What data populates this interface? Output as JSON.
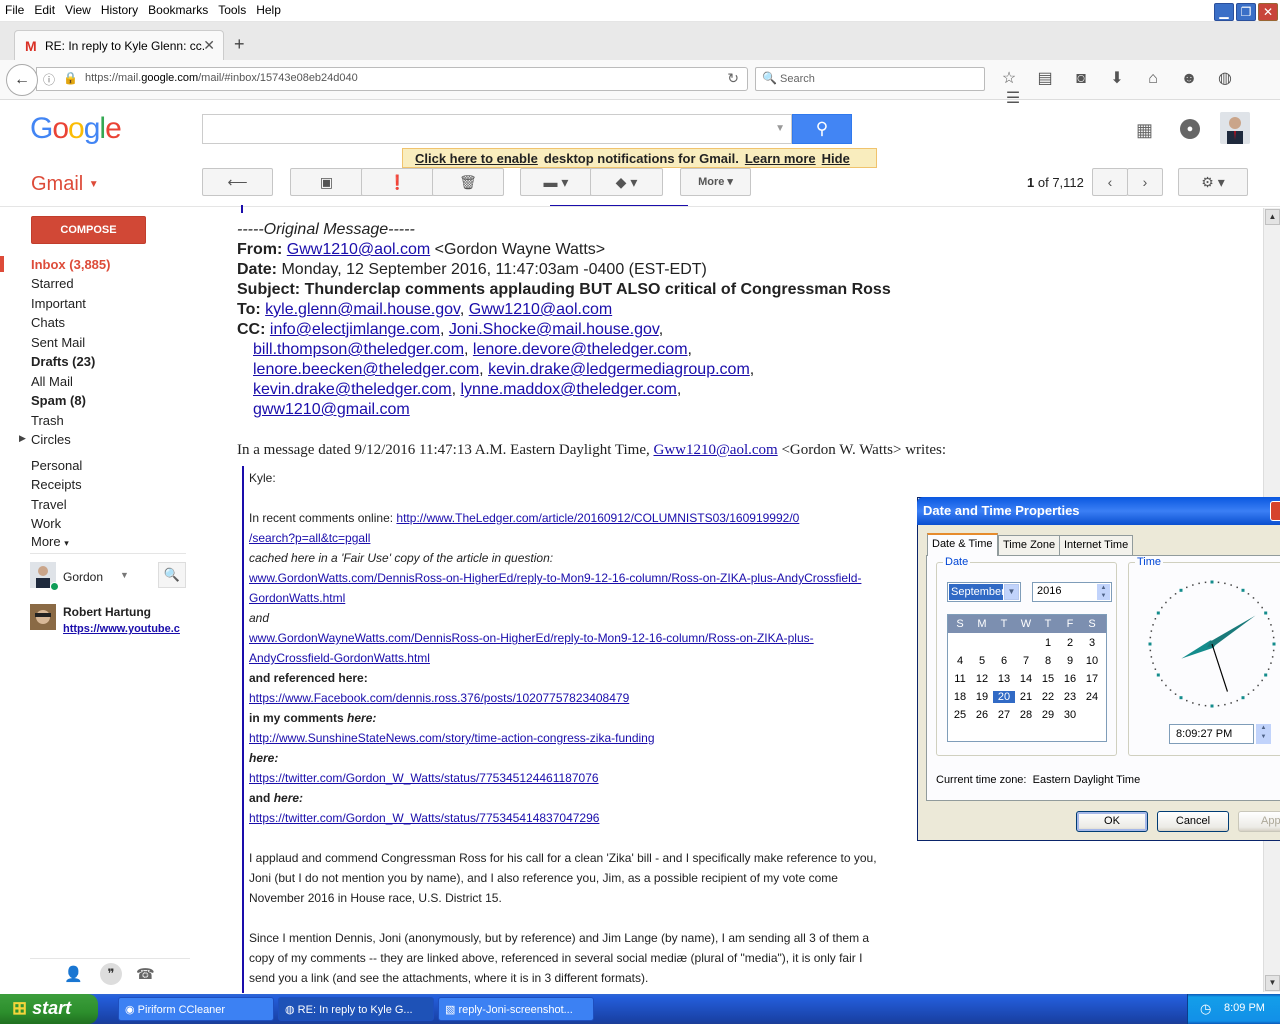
{
  "menu": [
    "File",
    "Edit",
    "View",
    "History",
    "Bookmarks",
    "Tools",
    "Help"
  ],
  "browser": {
    "tab_title": "RE: In reply to Kyle Glenn: cc...",
    "url_pre": "https://mail.",
    "url_host": "google.com",
    "url_post": "/mail/#inbox/15743e08eb24d040",
    "search_placeholder": "Search"
  },
  "google": {
    "logo": "Google"
  },
  "notification": {
    "enable": "Click here to enable",
    "rest": "desktop notifications for Gmail.",
    "learn": "Learn more",
    "hide": "Hide"
  },
  "gmail": {
    "label": "Gmail",
    "more": "More",
    "pager_current": "1",
    "pager_of": "of",
    "pager_total": "7,112",
    "compose": "COMPOSE",
    "nav": [
      {
        "label": "Inbox (3,885)"
      },
      {
        "label": "Starred"
      },
      {
        "label": "Important"
      },
      {
        "label": "Chats"
      },
      {
        "label": "Sent Mail"
      },
      {
        "label": "Drafts (23)"
      },
      {
        "label": "All Mail"
      },
      {
        "label": "Spam (8)"
      },
      {
        "label": "Trash"
      },
      {
        "label": "Circles"
      },
      {
        "label": "Personal"
      },
      {
        "label": "Receipts"
      },
      {
        "label": "Travel"
      },
      {
        "label": "Work"
      },
      {
        "label": "More"
      }
    ],
    "hangouts_user": "Gordon",
    "contact_name": "Robert Hartung",
    "contact_link": "https://www.youtube.c"
  },
  "email": {
    "orig": "-----Original Message-----",
    "from_label": "From:",
    "from_addr": "Gww1210@aol.com",
    "from_name": "<Gordon Wayne Watts>",
    "date_label": "Date:",
    "date_val": "Monday, 12 September 2016, 11:47:03am -0400 (EST-EDT)",
    "subject": "Subject: Thunderclap comments applauding BUT ALSO critical of Congressman Ross",
    "to_label": "To:",
    "to1": "kyle.glenn@mail.house.gov",
    "to2": "Gww1210@aol.com",
    "cc_label": "CC:",
    "cc1": "info@electjimlange.com",
    "cc2": "Joni.Shocke@mail.house.gov",
    "cc3": "bill.thompson@theledger.com",
    "cc4": "lenore.devore@theledger.com",
    "cc5": "lenore.beecken@theledger.com",
    "cc6": "kevin.drake@ledgermediagroup.com",
    "cc7": "kevin.drake@theledger.com",
    "cc8": "lynne.maddox@theledger.com",
    "cc9": "gww1210@gmail.com",
    "msg_pre": "In a message dated 9/12/2016 11:47:13 A.M. Eastern Daylight Time,",
    "msg_addr": "Gww1210@aol.com",
    "msg_post": "<Gordon W. Watts> writes:",
    "salut": "Kyle:",
    "l1_pre": "In recent comments online:",
    "l1_link": "http://www.TheLedger.com/article/20160912/COLUMNISTS03/160919992/0",
    "l2_link": "/search?p=all&tc=pgall",
    "l3": "cached here in a 'Fair Use' copy of the article in question:",
    "l4_link": "www.GordonWatts.com/DennisRoss-on-HigherEd/reply-to-Mon9-12-16-column/Ross-on-ZIKA-plus-AndyCrossfield-",
    "l5_link": "GordonWatts.html",
    "l6": "and",
    "l7_link": "www.GordonWayneWatts.com/DennisRoss-on-HigherEd/reply-to-Mon9-12-16-column/Ross-on-ZIKA-plus-",
    "l8_link": "AndyCrossfield-GordonWatts.html",
    "l9": "and referenced here:",
    "l10_link": "https://www.Facebook.com/dennis.ross.376/posts/10207757823408479",
    "l11_a": "in my comments",
    "l11_b": "here:",
    "l12_link": "http://www.SunshineStateNews.com/story/time-action-congress-zika-funding",
    "l13": "here:",
    "l14_link": "https://twitter.com/Gordon_W_Watts/status/775345124461187076",
    "l15_a": "and",
    "l15_b": "here:",
    "l16_link": "https://twitter.com/Gordon_W_Watts/status/775345414837047296",
    "p1": "I applaud and commend Congressman Ross for his call for a clean 'Zika' bill - and I specifically make reference to you,",
    "p2": "Joni (but I do not mention you by name), and I also reference you, Jim, as a possible recipient of my vote come",
    "p3": "November 2016 in House race, U.S. District 15.",
    "p4": "Since I mention Dennis, Joni (anonymously, but by reference) and Jim Lange (by name), I am sending all 3 of them a",
    "p5": "copy of my comments -- they are linked above, referenced in several social mediæ (plural of \"media\"), it is only fair I",
    "p6": "send you a link (and see the attachments, where it is in 3 different formats)."
  },
  "dialog": {
    "title": "Date and Time Properties",
    "tabs": [
      "Date & Time",
      "Time Zone",
      "Internet Time"
    ],
    "date_legend": "Date",
    "time_legend": "Time",
    "month": "September",
    "year": "2016",
    "weekdays": [
      "S",
      "M",
      "T",
      "W",
      "T",
      "F",
      "S"
    ],
    "days": [
      "1",
      "2",
      "3",
      "4",
      "5",
      "6",
      "7",
      "8",
      "9",
      "10",
      "11",
      "12",
      "13",
      "14",
      "15",
      "16",
      "17",
      "18",
      "19",
      "20",
      "21",
      "22",
      "23",
      "24",
      "25",
      "26",
      "27",
      "28",
      "29",
      "30"
    ],
    "selected_day": 20,
    "time": "8:09:27 PM",
    "tz_label": "Current time zone:",
    "tz_value": "Eastern Daylight Time",
    "ok": "OK",
    "cancel": "Cancel",
    "apply": "App"
  },
  "taskbar": {
    "start": "start",
    "items": [
      "Piriform CCleaner",
      "RE: In reply to Kyle G...",
      "reply-Joni-screenshot..."
    ],
    "clock": "8:09 PM"
  },
  "colors": {
    "gmail_red": "#dd4b39",
    "google_blue": "#4285f4",
    "link": "#1a0dab",
    "xp_blue": "#245edb"
  }
}
